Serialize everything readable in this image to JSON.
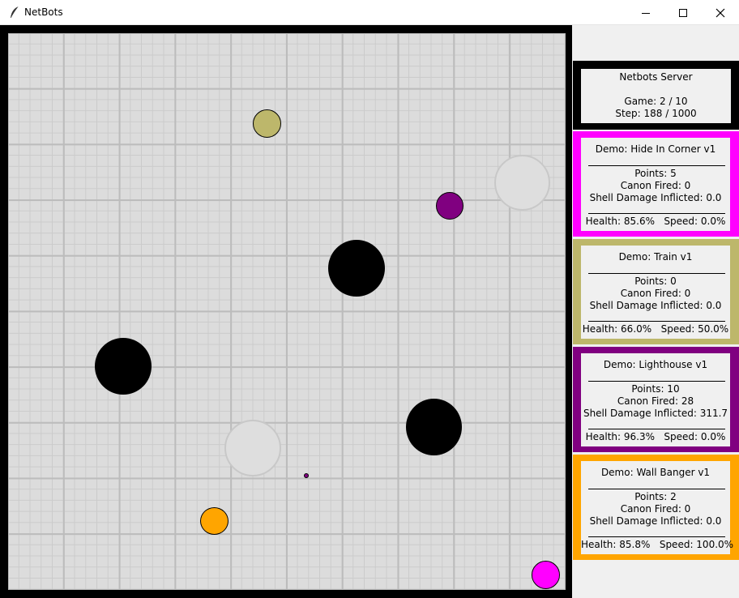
{
  "window": {
    "title": "NetBots"
  },
  "server": {
    "name": "Netbots Server",
    "game": "Game: 2 / 10",
    "step": "Step: 188 / 1000"
  },
  "bots": [
    {
      "name": "Demo: Hide In Corner v1",
      "points": "Points: 5",
      "canon": "Canon Fired: 0",
      "damage": "Shell Damage Inflicted: 0.0",
      "status": "Health: 85.6%   Speed: 0.0%",
      "color": "#ff00ff"
    },
    {
      "name": "Demo: Train v1",
      "points": "Points: 0",
      "canon": "Canon Fired: 0",
      "damage": "Shell Damage Inflicted: 0.0",
      "status": "Health: 66.0%   Speed: 50.0%",
      "color": "#bdb76b"
    },
    {
      "name": "Demo: Lighthouse v1",
      "points": "Points: 10",
      "canon": "Canon Fired: 28",
      "damage": "Shell Damage Inflicted: 311.7",
      "status": "Health: 96.3%   Speed: 0.0%",
      "color": "#800080"
    },
    {
      "name": "Demo: Wall Banger v1",
      "points": "Points: 2",
      "canon": "Canon Fired: 0",
      "damage": "Shell Damage Inflicted: 0.0",
      "status": "Health: 85.8%   Speed: 100.0%",
      "color": "#ffa500"
    }
  ],
  "colors": {
    "obstacle": "#000000",
    "trap": "#dddddd",
    "grid_background": "#dcdcdc"
  }
}
